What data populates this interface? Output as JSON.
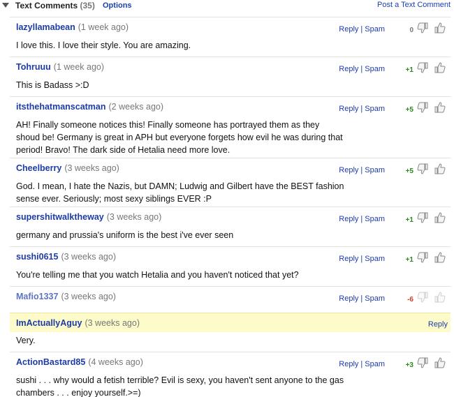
{
  "header": {
    "title": "Text Comments",
    "count": "(35)",
    "options": "Options",
    "post_link": "Post a Text Comment"
  },
  "links": {
    "reply": "Reply",
    "spam": "Spam",
    "sep": "|"
  },
  "comments": [
    {
      "author": "lazyllamabean",
      "time": "(1 week ago)",
      "body": "I love this. I love their style. You are amazing.",
      "score": "0"
    },
    {
      "author": "Tohruuu",
      "time": "(1 week ago)",
      "body": "This is Badass >:D",
      "score": "+1"
    },
    {
      "author": "itsthehatmanscatman",
      "time": "(2 weeks ago)",
      "body": "AH! Finally someone notices this! Finally someone has portrayed them as they shoud be! Germany is great in APH but everyone forgets how evil he was during that period! Bravo! The dark side of Hetalia need more love.",
      "score": "+5"
    },
    {
      "author": "Cheelberry",
      "time": "(3 weeks ago)",
      "body": "God. I mean, I hate the Nazis, but DAMN; Ludwig and Gilbert have the BEST fashion sense ever. Seriously; most sexy siblings EVER :P",
      "score": "+5"
    },
    {
      "author": "supershitwalktheway",
      "time": "(3 weeks ago)",
      "body": "germany and prussia's uniform is the best i've ever seen",
      "score": "+1"
    },
    {
      "author": "sushi0615",
      "time": "(3 weeks ago)",
      "body": "You're telling me that you watch Hetalia and you haven't noticed that yet?",
      "score": "+1"
    },
    {
      "author": "Mafio1337",
      "time": "(3 weeks ago)",
      "body": "",
      "score": "-6"
    },
    {
      "author": "ImActuallyAguy",
      "time": "(3 weeks ago)",
      "body": "Very.",
      "score": ""
    },
    {
      "author": "ActionBastard85",
      "time": "(4 weeks ago)",
      "body": "sushi . . . why would a fetish terrible? Evil is sexy, you haven't sent anyone to the gas chambers . . . enjoy yourself.>=)",
      "score": "+3"
    }
  ],
  "colors": {
    "link": "#1d3ba8",
    "positive": "#2a8a19",
    "negative": "#d23a2b",
    "highlight": "#fdfbc9"
  }
}
